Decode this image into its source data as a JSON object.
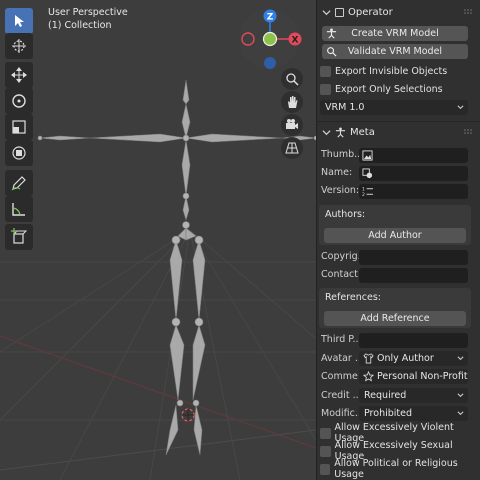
{
  "viewport": {
    "view_name": "User Perspective",
    "collection": "(1) Collection"
  },
  "toolbar": {
    "tools": [
      "select-box-tool",
      "cursor-tool",
      "move-tool",
      "rotate-tool",
      "scale-tool",
      "transform-tool",
      "annotate-tool",
      "measure-tool",
      "add-cube-tool"
    ],
    "active": "select-box-tool"
  },
  "gizmo": {
    "z_label": "Z",
    "x_label": "X",
    "colors": {
      "x": "#e24a5a",
      "y": "#8bc34a",
      "z": "#2f80e8"
    }
  },
  "operator": {
    "title": "Operator",
    "create_label": "Create VRM Model",
    "validate_label": "Validate VRM Model",
    "export_invisible_label": "Export Invisible Objects",
    "export_selection_label": "Export Only Selections",
    "version_value": "VRM 1.0"
  },
  "meta": {
    "title": "Meta",
    "thumbnail_label": "Thumb...",
    "name_label": "Name:",
    "version_label": "Version:",
    "authors_title": "Authors:",
    "add_author_label": "Add Author",
    "copyright_label": "Copyrig...",
    "contact_label": "Contact...",
    "references_title": "References:",
    "add_reference_label": "Add Reference",
    "third_party_label": "Third P...",
    "avatar_label": "Avatar ...",
    "avatar_value": "Only Author",
    "commercial_label": "Comme",
    "commercial_value": "Personal Non-Profit",
    "credit_label": "Credit ...",
    "credit_value": "Required",
    "modification_label": "Modific...",
    "modification_value": "Prohibited",
    "violent_label": "Allow Excessively Violent Usage",
    "sexual_label": "Allow Excessively Sexual Usage",
    "political_label": "Allow Political or Religious Usage"
  },
  "colors": {
    "accent": "#4772b3",
    "viewport_bg": "#3d3d3d",
    "panel_bg": "#303030"
  }
}
